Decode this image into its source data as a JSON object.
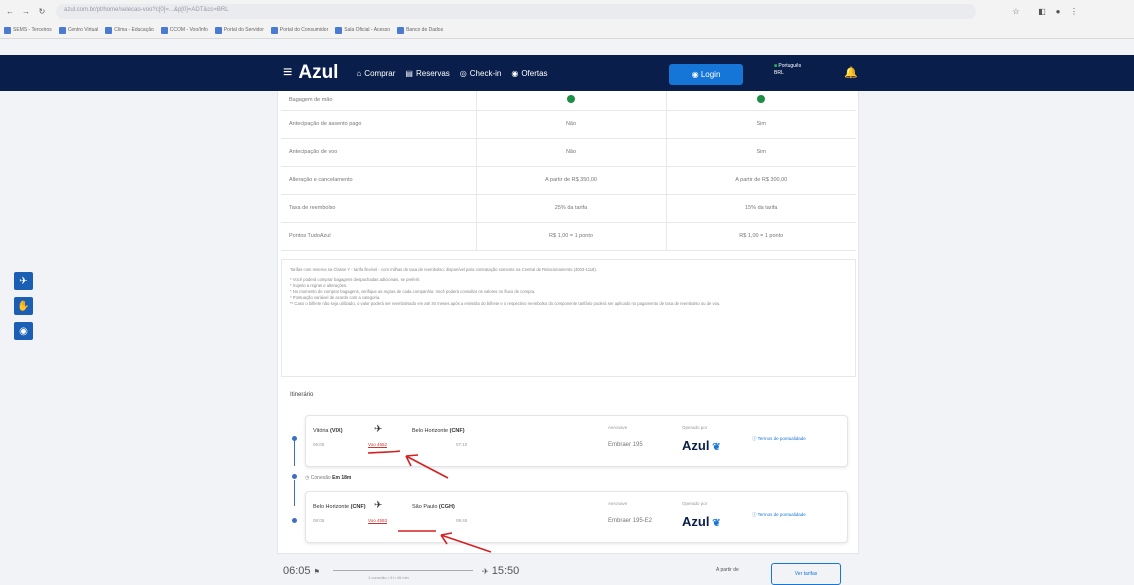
{
  "browser": {
    "url": "azul.com.br/pt/home/selecao-voo?c[0]=...&p[0]=ADT&cc=BRL",
    "bookmarks": [
      "SEMS - Terceiros",
      "Centro Virtual",
      "Clima - Educação",
      "CCOM - Voo/Info",
      "Portal do Servidor",
      "Portal do Consumidor",
      "Sala Oficial - Acesso",
      "Banco de Dados"
    ]
  },
  "header": {
    "logo": "Azul",
    "nav": [
      {
        "icon": "cart-icon",
        "label": "Comprar"
      },
      {
        "icon": "calendar-icon",
        "label": "Reservas"
      },
      {
        "icon": "checkin-icon",
        "label": "Check-in"
      },
      {
        "icon": "offers-icon",
        "label": "Ofertas"
      }
    ],
    "login": "Login",
    "language": "Português",
    "currency": "BRL"
  },
  "comparison": {
    "rows": [
      {
        "label": "Bagagem de mão",
        "col1": "",
        "col2": ""
      },
      {
        "label": "Antecipação de assento pago",
        "col1": "Não",
        "col2": "Sim"
      },
      {
        "label": "Antecipação de voo",
        "col1": "Não",
        "col2": "Sim"
      },
      {
        "label": "Alteração e cancelamento",
        "col1": "A partir de R$ 350,00",
        "col2": "A partir de R$ 300,00"
      },
      {
        "label": "Taxa de reembolso",
        "col1": "25% da tarifa",
        "col2": "15% da tarifa"
      },
      {
        "label": "Pontos TudoAzul",
        "col1": "R$ 1,00 = 1 ponto",
        "col2": "R$ 1,00 = 1 ponto"
      }
    ]
  },
  "notes": [
    "Tarifas com reserva na Classe Y - tarifa flexível - com milhas de taxa de reembolso; disponível para contratação somente na Central de Relacionamento (4003-1118).",
    "* Você poderá comprar bagagens despachadas adicionais, se preferir.",
    "* Sujeito a regras e alterações.",
    "* No momento de comprar bagagens, verifique as regras de cada companhia. Você poderá consultar os valores no fluxo de compra.",
    "* Pontuação variável de acordo com a categoria.",
    "** Caso o bilhete não seja utilizado, o valor poderá ser reembolsado em até 30 meses após a emissão do bilhete e o respectivo reembolso do componente tarifário poderá ser aplicado no pagamento de taxa de reembolso ou de voo."
  ],
  "itinerary": {
    "title": "Itinerário",
    "connection_label": "Conexão",
    "connection_time": "Em 18m",
    "segments": [
      {
        "origin": "Vitória",
        "origin_code": "(VIX)",
        "dest": "Belo Horizonte",
        "dest_code": "(CNF)",
        "dep_time": "06:05",
        "arr_time": "07:10",
        "flight": "Voo 4552",
        "equipment_label": "Aeronave",
        "equipment": "Embraer 195",
        "operated_label": "Operado por",
        "operator": "Azul",
        "link": "Termos de pontualidade"
      },
      {
        "origin": "Belo Horizonte",
        "origin_code": "(CNF)",
        "dest": "São Paulo",
        "dest_code": "(CGH)",
        "dep_time": "08:05",
        "arr_time": "09:45",
        "flight": "Voo 4593",
        "equipment_label": "Aeronave",
        "equipment": "Embraer 195-E2",
        "operated_label": "Operado por",
        "operator": "Azul",
        "link": "Termos de pontualidade"
      }
    ]
  },
  "result": {
    "dep": "06:05",
    "arr": "15:50",
    "duration": "1 conexão • 9 h 45 min",
    "from_label": "A partir de",
    "select": "Ver tarifas"
  },
  "accessibility": [
    "accessibility-icon",
    "sign-language-icon",
    "hide-icon"
  ],
  "colors": {
    "brand": "#0a1e4b",
    "accent": "#1676d8",
    "ok": "#1b8d46",
    "annotation": "#d62020"
  }
}
